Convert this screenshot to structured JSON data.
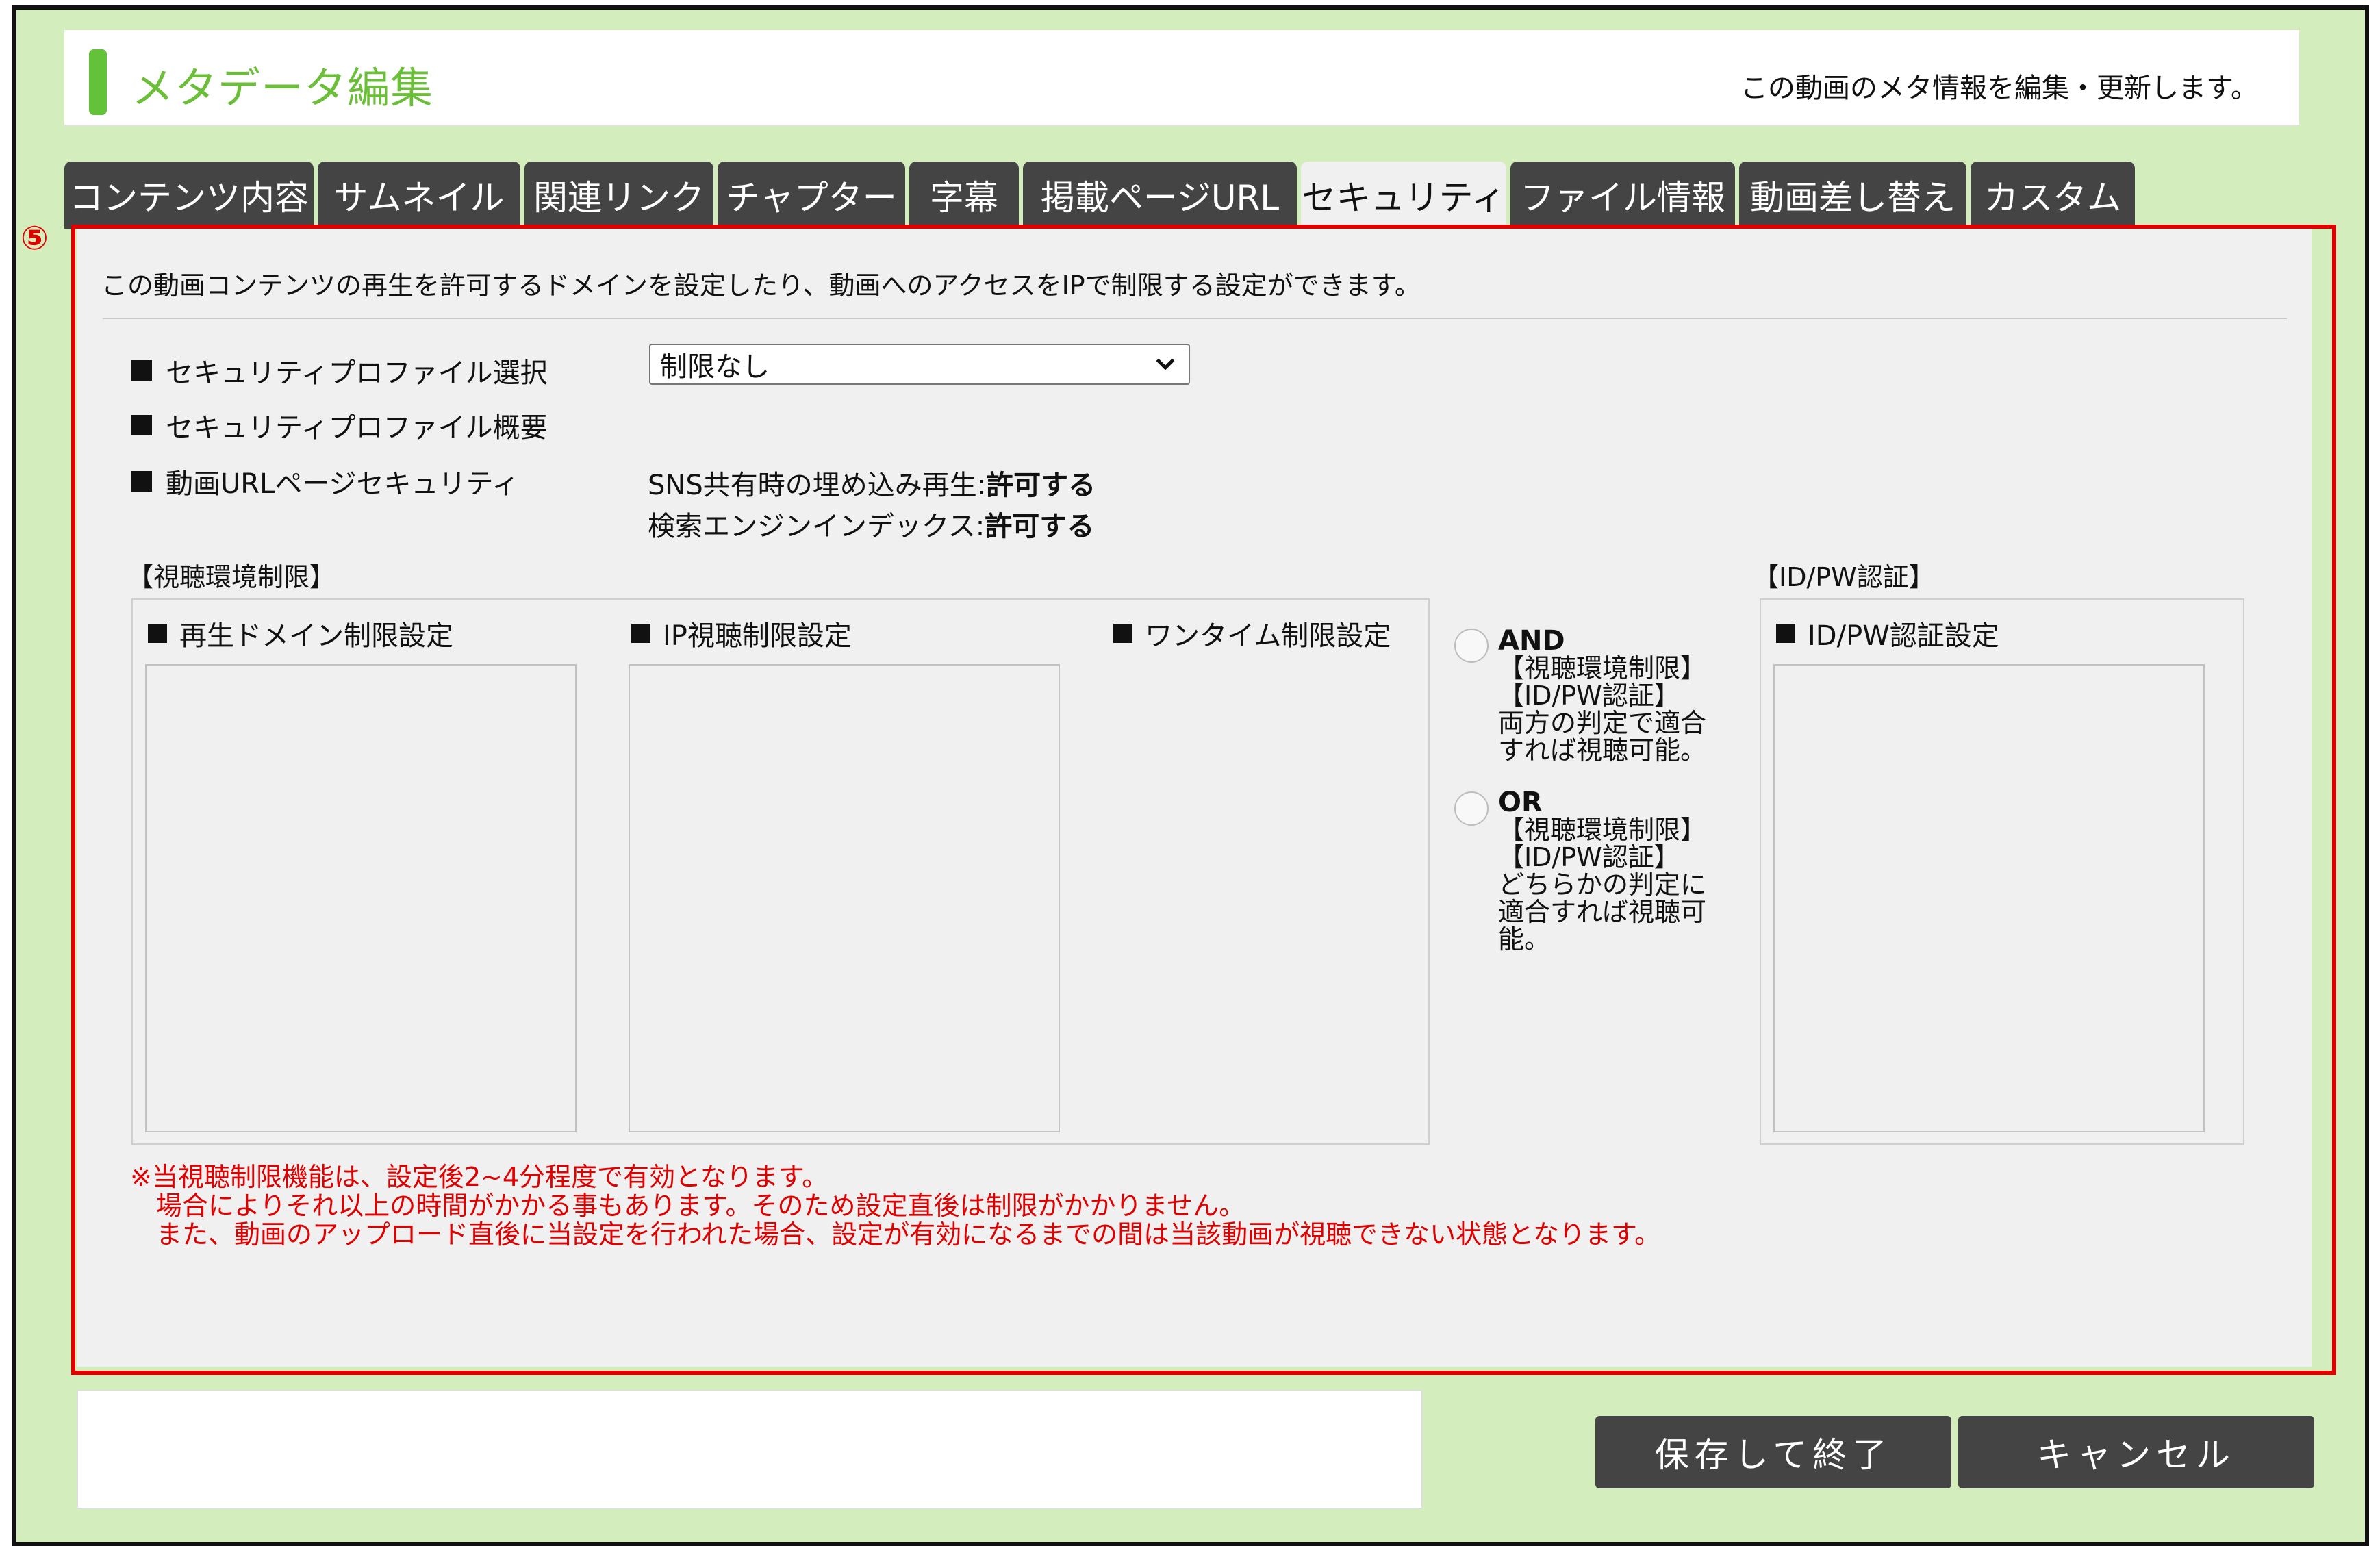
{
  "header": {
    "title": "メタデータ編集",
    "subtitle": "この動画のメタ情報を編集・更新します。"
  },
  "tabs": [
    {
      "label": "コンテンツ内容"
    },
    {
      "label": "サムネイル"
    },
    {
      "label": "関連リンク"
    },
    {
      "label": "チャプター"
    },
    {
      "label": "字幕"
    },
    {
      "label": "掲載ページURL"
    },
    {
      "label": "セキュリティ",
      "active": true
    },
    {
      "label": "ファイル情報"
    },
    {
      "label": "動画差し替え"
    },
    {
      "label": "カスタム"
    }
  ],
  "annotation": {
    "marker": "⑤",
    "color": "#e00000"
  },
  "security": {
    "description": "この動画コンテンツの再生を許可するドメインを設定したり、動画へのアクセスをIPで制限する設定ができます。",
    "profile_select_label": "セキュリティプロファイル選択",
    "profile_select_value": "制限なし",
    "profile_summary_label": "セキュリティプロファイル概要",
    "url_page_security_label": "動画URLページセキュリティ",
    "sns_embed_prefix": "SNS共有時の埋め込み再生:",
    "sns_embed_value": "許可する",
    "search_index_prefix": "検索エンジンインデックス:",
    "search_index_value": "許可する"
  },
  "env_restriction": {
    "group_label": "【視聴環境制限】",
    "domain_label": "再生ドメイン制限設定",
    "ip_label": "IP視聴制限設定",
    "onetime_label": "ワンタイム制限設定"
  },
  "logic": {
    "and_title": "AND",
    "and_line1": "【視聴環境制限】",
    "and_line2": "【ID/PW認証】",
    "and_line3": "両方の判定で適合",
    "and_line4": "すれば視聴可能。",
    "or_title": "OR",
    "or_line1": "【視聴環境制限】",
    "or_line2": "【ID/PW認証】",
    "or_line3": "どちらかの判定に",
    "or_line4": "適合すれば視聴可",
    "or_line5": "能。"
  },
  "idpw": {
    "group_label": "【ID/PW認証】",
    "setting_label": "ID/PW認証設定"
  },
  "notes": {
    "line1": "※当視聴制限機能は、設定後2~4分程度で有効となります。",
    "line2": "　場合によりそれ以上の時間がかかる事もあります。そのため設定直後は制限がかかりません。",
    "line3": "　また、動画のアップロード直後に当設定を行われた場合、設定が有効になるまでの間は当該動画が視聴できない状態となります。"
  },
  "buttons": {
    "save_label": "保存して終了",
    "cancel_label": "キャンセル"
  }
}
